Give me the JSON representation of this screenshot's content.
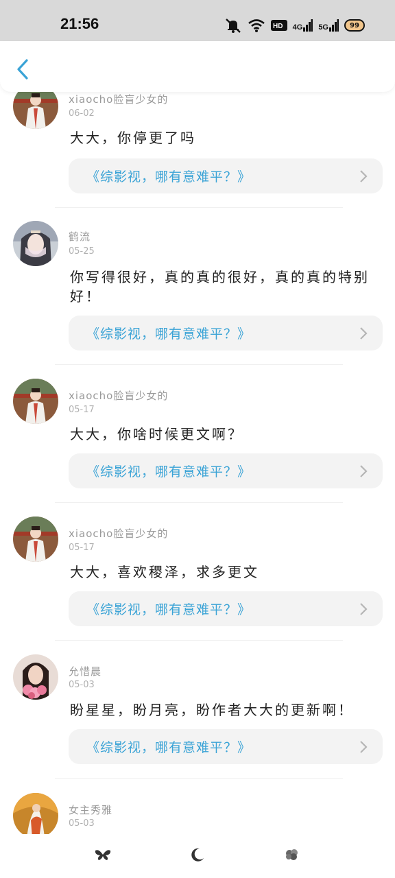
{
  "status_bar": {
    "time": "21:56",
    "hd_label": "HD",
    "net1_label": "4G",
    "net2_label": "5G",
    "battery": "99"
  },
  "header": {
    "back_icon": "chevron-left-icon",
    "accent_color": "#3aa3d6"
  },
  "comments": [
    {
      "username": "xiaocho脸盲少女的",
      "date": "06-02",
      "content": "大大，你停更了吗",
      "book": "《综影视，哪有意难平？》"
    },
    {
      "username": "鹤流",
      "date": "05-25",
      "content": "你写得很好，真的真的很好，真的真的特别好！",
      "book": "《综影视，哪有意难平？》"
    },
    {
      "username": "xiaocho脸盲少女的",
      "date": "05-17",
      "content": "大大，你啥时候更文啊？",
      "book": "《综影视，哪有意难平？》"
    },
    {
      "username": "xiaocho脸盲少女的",
      "date": "05-17",
      "content": "大大，喜欢稷泽，求多更文",
      "book": "《综影视，哪有意难平？》"
    },
    {
      "username": "允惜晨",
      "date": "05-03",
      "content": "盼星星，盼月亮，盼作者大大的更新啊！",
      "book": "《综影视，哪有意难平？》"
    },
    {
      "username": "女主秀雅",
      "date": "05-03",
      "content": "",
      "book": ""
    }
  ],
  "bottom_nav": {
    "items": [
      "butterfly-icon",
      "moon-icon",
      "leaf-icon"
    ]
  }
}
